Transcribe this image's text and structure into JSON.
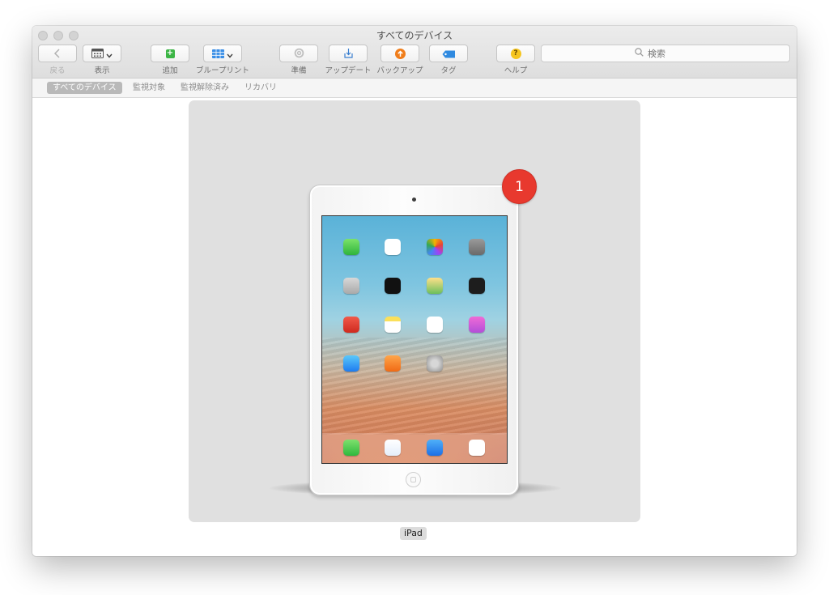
{
  "window": {
    "title": "すべてのデバイス"
  },
  "toolbar": {
    "back_label": "戻る",
    "view_label": "表示",
    "add_label": "追加",
    "blueprint_label": "ブループリント",
    "prepare_label": "準備",
    "update_label": "アップデート",
    "backup_label": "バックアップ",
    "tag_label": "タグ",
    "help_label": "ヘルプ",
    "help_symbol": "?"
  },
  "search": {
    "placeholder": "検索"
  },
  "scope_bar": {
    "items": [
      {
        "label": "すべてのデバイス",
        "selected": true
      },
      {
        "label": "監視対象",
        "selected": false
      },
      {
        "label": "監視解除済み",
        "selected": false
      },
      {
        "label": "リカバリ",
        "selected": false
      }
    ]
  },
  "devices": [
    {
      "name": "iPad",
      "badge_count": "1",
      "image": "ipad-white-icon"
    }
  ],
  "colors": {
    "badge_red": "#e8392e",
    "add_green": "#3cb545",
    "blueprint_blue": "#3a8ee6",
    "backup_orange": "#f07d1a",
    "tag_blue": "#2f8ae0",
    "help_yellow": "#f5c51f",
    "scope_selected": "#b9b9b9"
  }
}
